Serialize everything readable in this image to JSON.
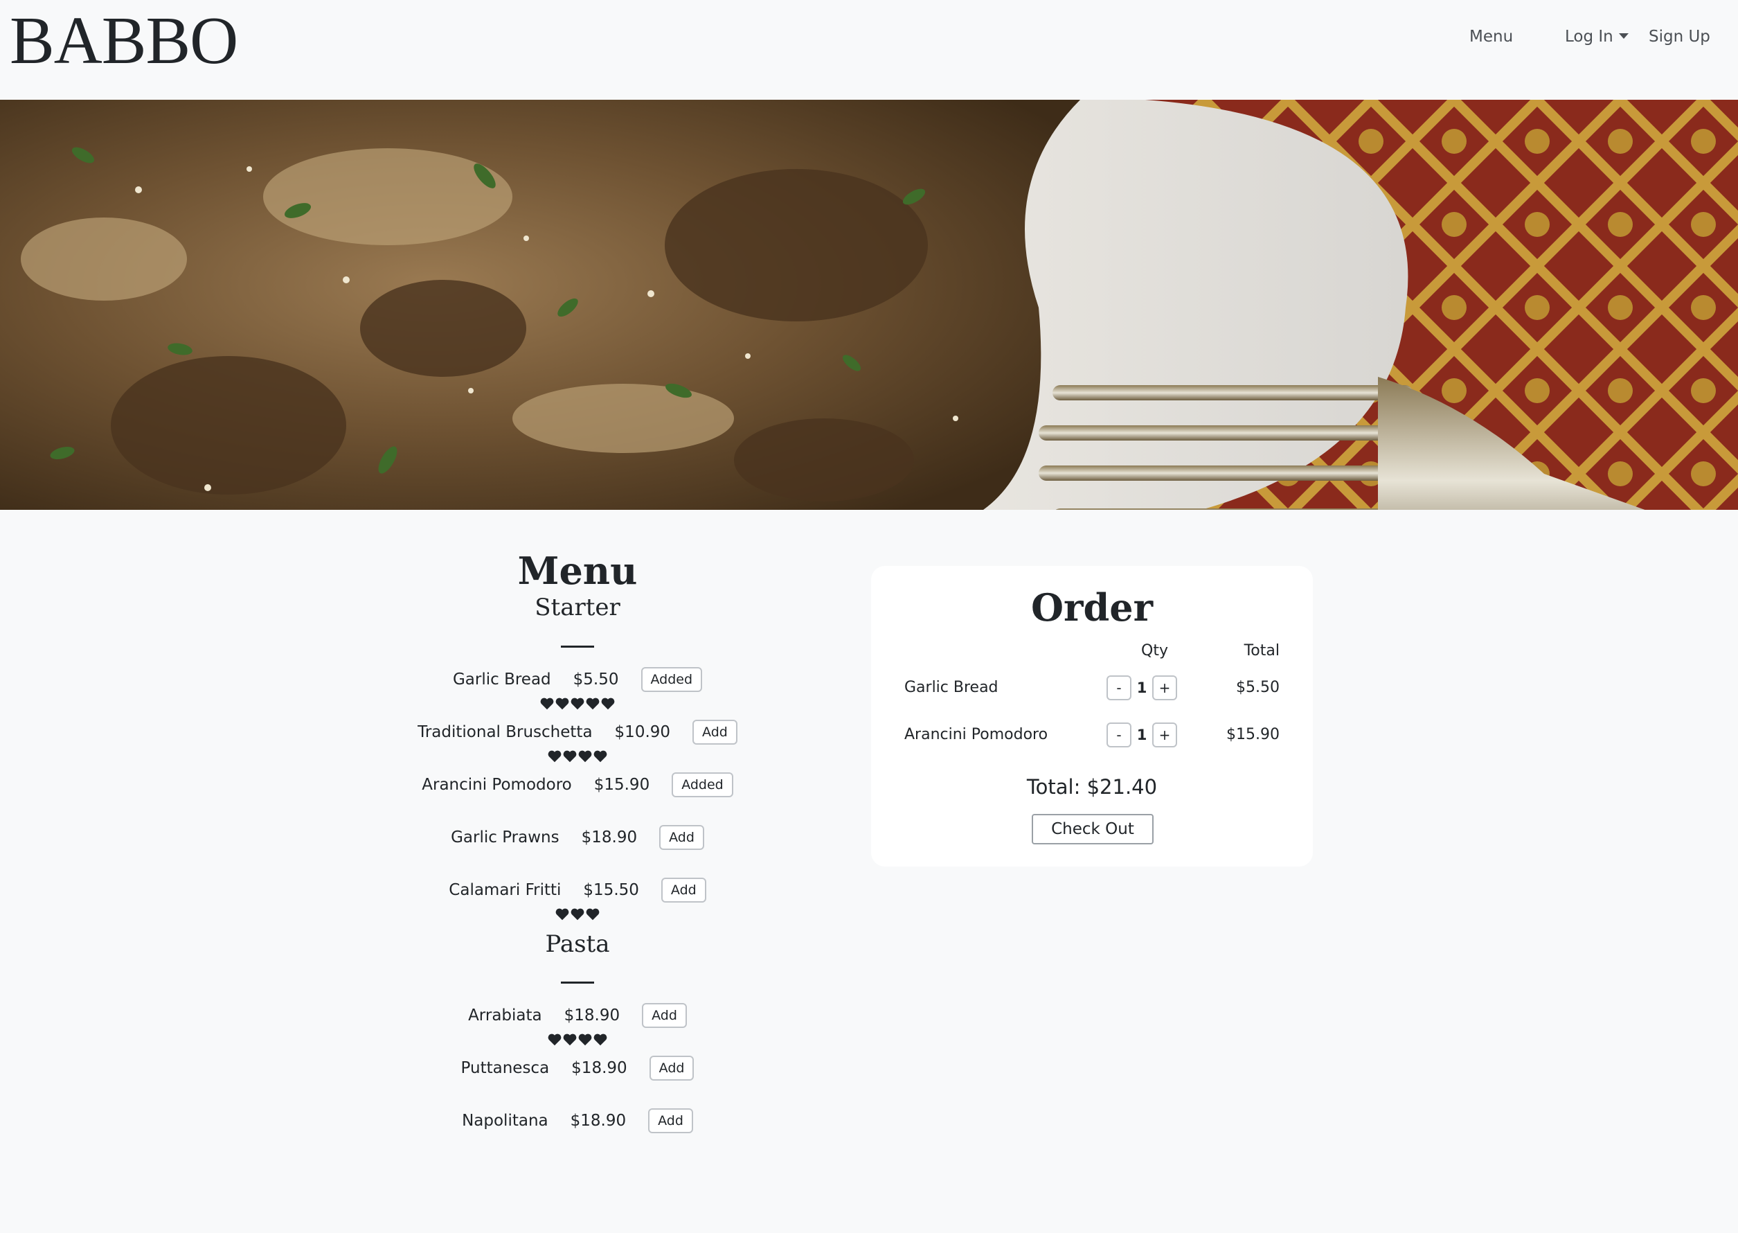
{
  "header": {
    "logo": "BABBO",
    "nav": {
      "menu": "Menu",
      "login": "Log In",
      "signup": "Sign Up"
    }
  },
  "menu": {
    "title": "Menu",
    "sections": [
      {
        "title": "Starter",
        "items": [
          {
            "name": "Garlic Bread",
            "price": "$5.50",
            "button": "Added",
            "hearts": 5
          },
          {
            "name": "Traditional Bruschetta",
            "price": "$10.90",
            "button": "Add",
            "hearts": 4
          },
          {
            "name": "Arancini Pomodoro",
            "price": "$15.90",
            "button": "Added",
            "hearts": 0
          },
          {
            "name": "Garlic Prawns",
            "price": "$18.90",
            "button": "Add",
            "hearts": 0
          },
          {
            "name": "Calamari Fritti",
            "price": "$15.50",
            "button": "Add",
            "hearts": 3
          }
        ]
      },
      {
        "title": "Pasta",
        "items": [
          {
            "name": "Arrabiata",
            "price": "$18.90",
            "button": "Add",
            "hearts": 4
          },
          {
            "name": "Puttanesca",
            "price": "$18.90",
            "button": "Add",
            "hearts": 0
          },
          {
            "name": "Napolitana",
            "price": "$18.90",
            "button": "Add",
            "hearts": 0
          }
        ]
      }
    ]
  },
  "order": {
    "title": "Order",
    "col_qty": "Qty",
    "col_total": "Total",
    "rows": [
      {
        "name": "Garlic Bread",
        "minus": "-",
        "qty": "1",
        "plus": "+",
        "total": "$5.50"
      },
      {
        "name": "Arancini Pomodoro",
        "minus": "-",
        "qty": "1",
        "plus": "+",
        "total": "$15.90"
      }
    ],
    "grand_total": "Total: $21.40",
    "checkout": "Check Out"
  }
}
